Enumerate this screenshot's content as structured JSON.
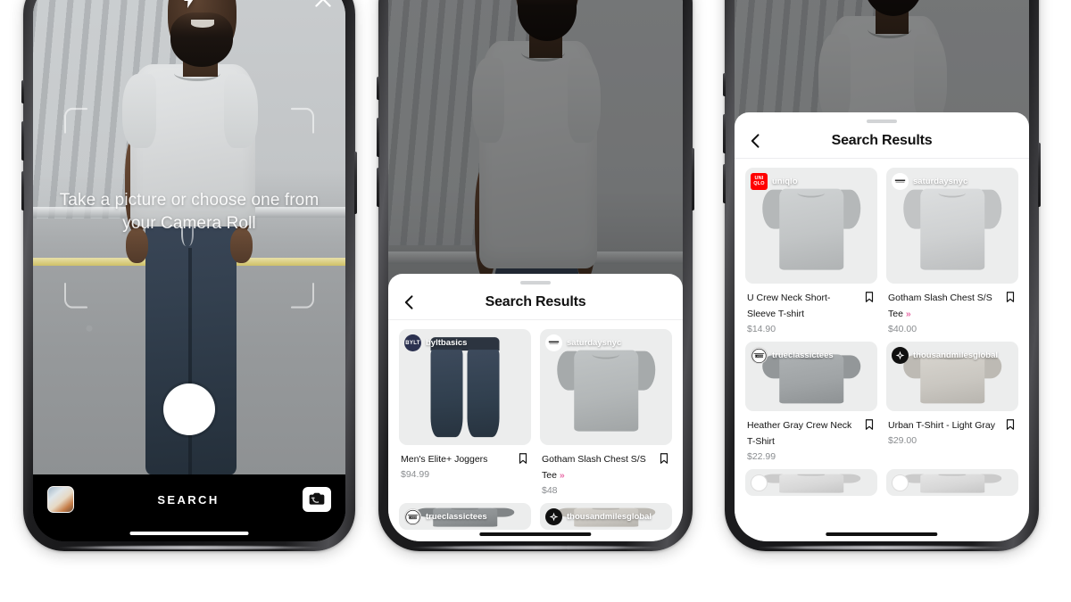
{
  "scene": {
    "background_color": "#ffffff",
    "phone_count": 3
  },
  "phone1": {
    "name": "camera-capture-screen",
    "icons": {
      "flash": "flash-icon",
      "close": "close-icon",
      "camera_roll": "camera-roll-thumbnail",
      "flip": "camera-flip-icon",
      "shutter": "shutter-button"
    },
    "hint_text": "Take a picture or choose one from your Camera Roll",
    "bottom_label": "SEARCH"
  },
  "phone2": {
    "name": "search-results-half-sheet",
    "icons": {
      "close": "close-icon",
      "back": "back-chevron-icon"
    },
    "sheet_title": "Search Results",
    "results": [
      {
        "brand": "byltbasics",
        "brand_logo": "bylt-logo",
        "brand_logo_color": "#2b3150",
        "brand_logo_text": "BYLT",
        "title": "Men's Elite+ Joggers",
        "title_suffix": "",
        "price": "$94.99",
        "product_type": "joggers",
        "product_color": "#36424f",
        "bookmark": "bookmark-icon"
      },
      {
        "brand": "saturdaysnyc",
        "brand_logo": "saturdaysnyc-logo",
        "brand_logo_color": "#ffffff",
        "brand_logo_text": "SNYC",
        "title": "Gotham Slash Chest S/S Tee",
        "title_suffix": "»",
        "price": "$48",
        "product_type": "tee",
        "product_color": "#b3b7b8",
        "bookmark": "bookmark-icon"
      },
      {
        "brand": "trueclassictees",
        "brand_logo": "trueclassictees-logo",
        "brand_logo_color": "#ffffff",
        "brand_logo_text": "TRUE",
        "title": "",
        "title_suffix": "",
        "price": "",
        "product_type": "tee",
        "product_color": "#8e9294",
        "bookmark": "bookmark-icon"
      },
      {
        "brand": "thousandmilesglobal",
        "brand_logo": "thousandmilesglobal-logo",
        "brand_logo_color": "#101010",
        "brand_logo_text": "",
        "title": "",
        "title_suffix": "",
        "price": "",
        "product_type": "tee",
        "product_color": "#c9c6c0",
        "bookmark": "bookmark-icon"
      }
    ]
  },
  "phone3": {
    "name": "search-results-full-sheet",
    "icons": {
      "close": "close-icon",
      "back": "back-chevron-icon"
    },
    "sheet_title": "Search Results",
    "results": [
      {
        "brand": "uniqlo",
        "brand_logo": "uniqlo-logo",
        "brand_logo_color": "#ff0000",
        "brand_logo_text": "UNI QLO",
        "title": "U Crew Neck Short-Sleeve T-shirt",
        "title_suffix": "",
        "price": "$14.90",
        "product_type": "tee",
        "product_color": "#c2c5c6",
        "bookmark": "bookmark-icon"
      },
      {
        "brand": "saturdaysnyc",
        "brand_logo": "saturdaysnyc-logo",
        "brand_logo_color": "#ffffff",
        "brand_logo_text": "SNYC",
        "title": "Gotham Slash Chest S/S Tee",
        "title_suffix": "»",
        "price": "$40.00",
        "product_type": "tee",
        "product_color": "#cfd1d2",
        "bookmark": "bookmark-icon"
      },
      {
        "brand": "trueclassictees",
        "brand_logo": "trueclassictees-logo",
        "brand_logo_color": "#ffffff",
        "brand_logo_text": "TRUE",
        "title": "Heather Gray Crew Neck T-Shirt",
        "title_suffix": "",
        "price": "$22.99",
        "product_type": "tee",
        "product_color": "#a0a4a6",
        "bookmark": "bookmark-icon"
      },
      {
        "brand": "thousandmilesglobal",
        "brand_logo": "thousandmilesglobal-logo",
        "brand_logo_color": "#101010",
        "brand_logo_text": "",
        "title": "Urban T-Shirt - Light Gray",
        "title_suffix": "",
        "price": "$29.00",
        "product_type": "tee",
        "product_color": "#cac7c1",
        "bookmark": "bookmark-icon"
      },
      {
        "brand": "",
        "brand_logo": "brand-logo",
        "brand_logo_color": "#ffffff",
        "brand_logo_text": "",
        "title": "",
        "title_suffix": "",
        "price": "",
        "product_type": "tee",
        "product_color": "#d8d8d8",
        "bookmark": "bookmark-icon"
      },
      {
        "brand": "",
        "brand_logo": "brand-logo",
        "brand_logo_color": "#ffffff",
        "brand_logo_text": "",
        "title": "",
        "title_suffix": "",
        "price": "",
        "product_type": "tee",
        "product_color": "#d8d8d8",
        "bookmark": "bookmark-icon"
      }
    ]
  }
}
